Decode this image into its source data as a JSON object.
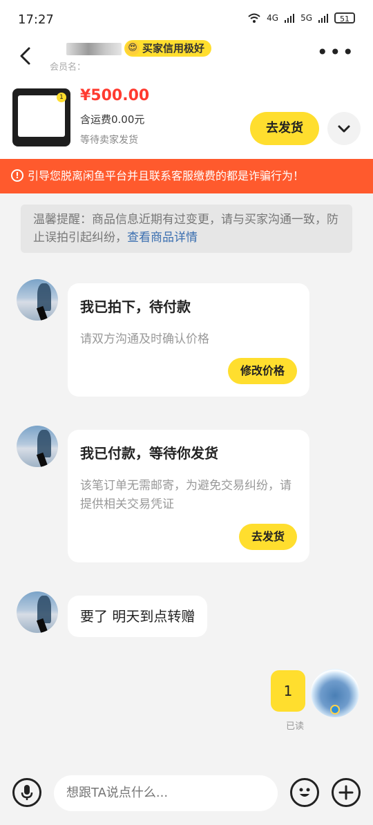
{
  "status_bar": {
    "time": "17:27",
    "network_1": "4G",
    "network_2": "5G",
    "battery": "51"
  },
  "header": {
    "credit_badge": "买家信用极好",
    "member_label": "会员名："
  },
  "product": {
    "price": "¥500.00",
    "shipping": "含运费0.00元",
    "status": "等待卖家发货",
    "thumb_badge": "1",
    "ship_button": "去发货"
  },
  "warning": {
    "icon": "!",
    "text": "引导您脱离闲鱼平台并且联系客服缴费的都是诈骗行为！"
  },
  "tip": {
    "text": "温馨提醒：商品信息近期有过变更，请与买家沟通一致，防止误拍引起纠纷，",
    "link": "查看商品详情"
  },
  "messages": [
    {
      "title": "我已拍下，待付款",
      "desc": "请双方沟通及时确认价格",
      "button": "修改价格"
    },
    {
      "title": "我已付款，等待你发货",
      "desc": "该笔订单无需邮寄，为避免交易纠纷，请提供相关交易凭证",
      "button": "去发货"
    },
    {
      "text": "要了 明天到点转赠"
    }
  ],
  "my_message": {
    "text": "1",
    "status": "已读"
  },
  "input": {
    "placeholder": "想跟TA说点什么..."
  }
}
